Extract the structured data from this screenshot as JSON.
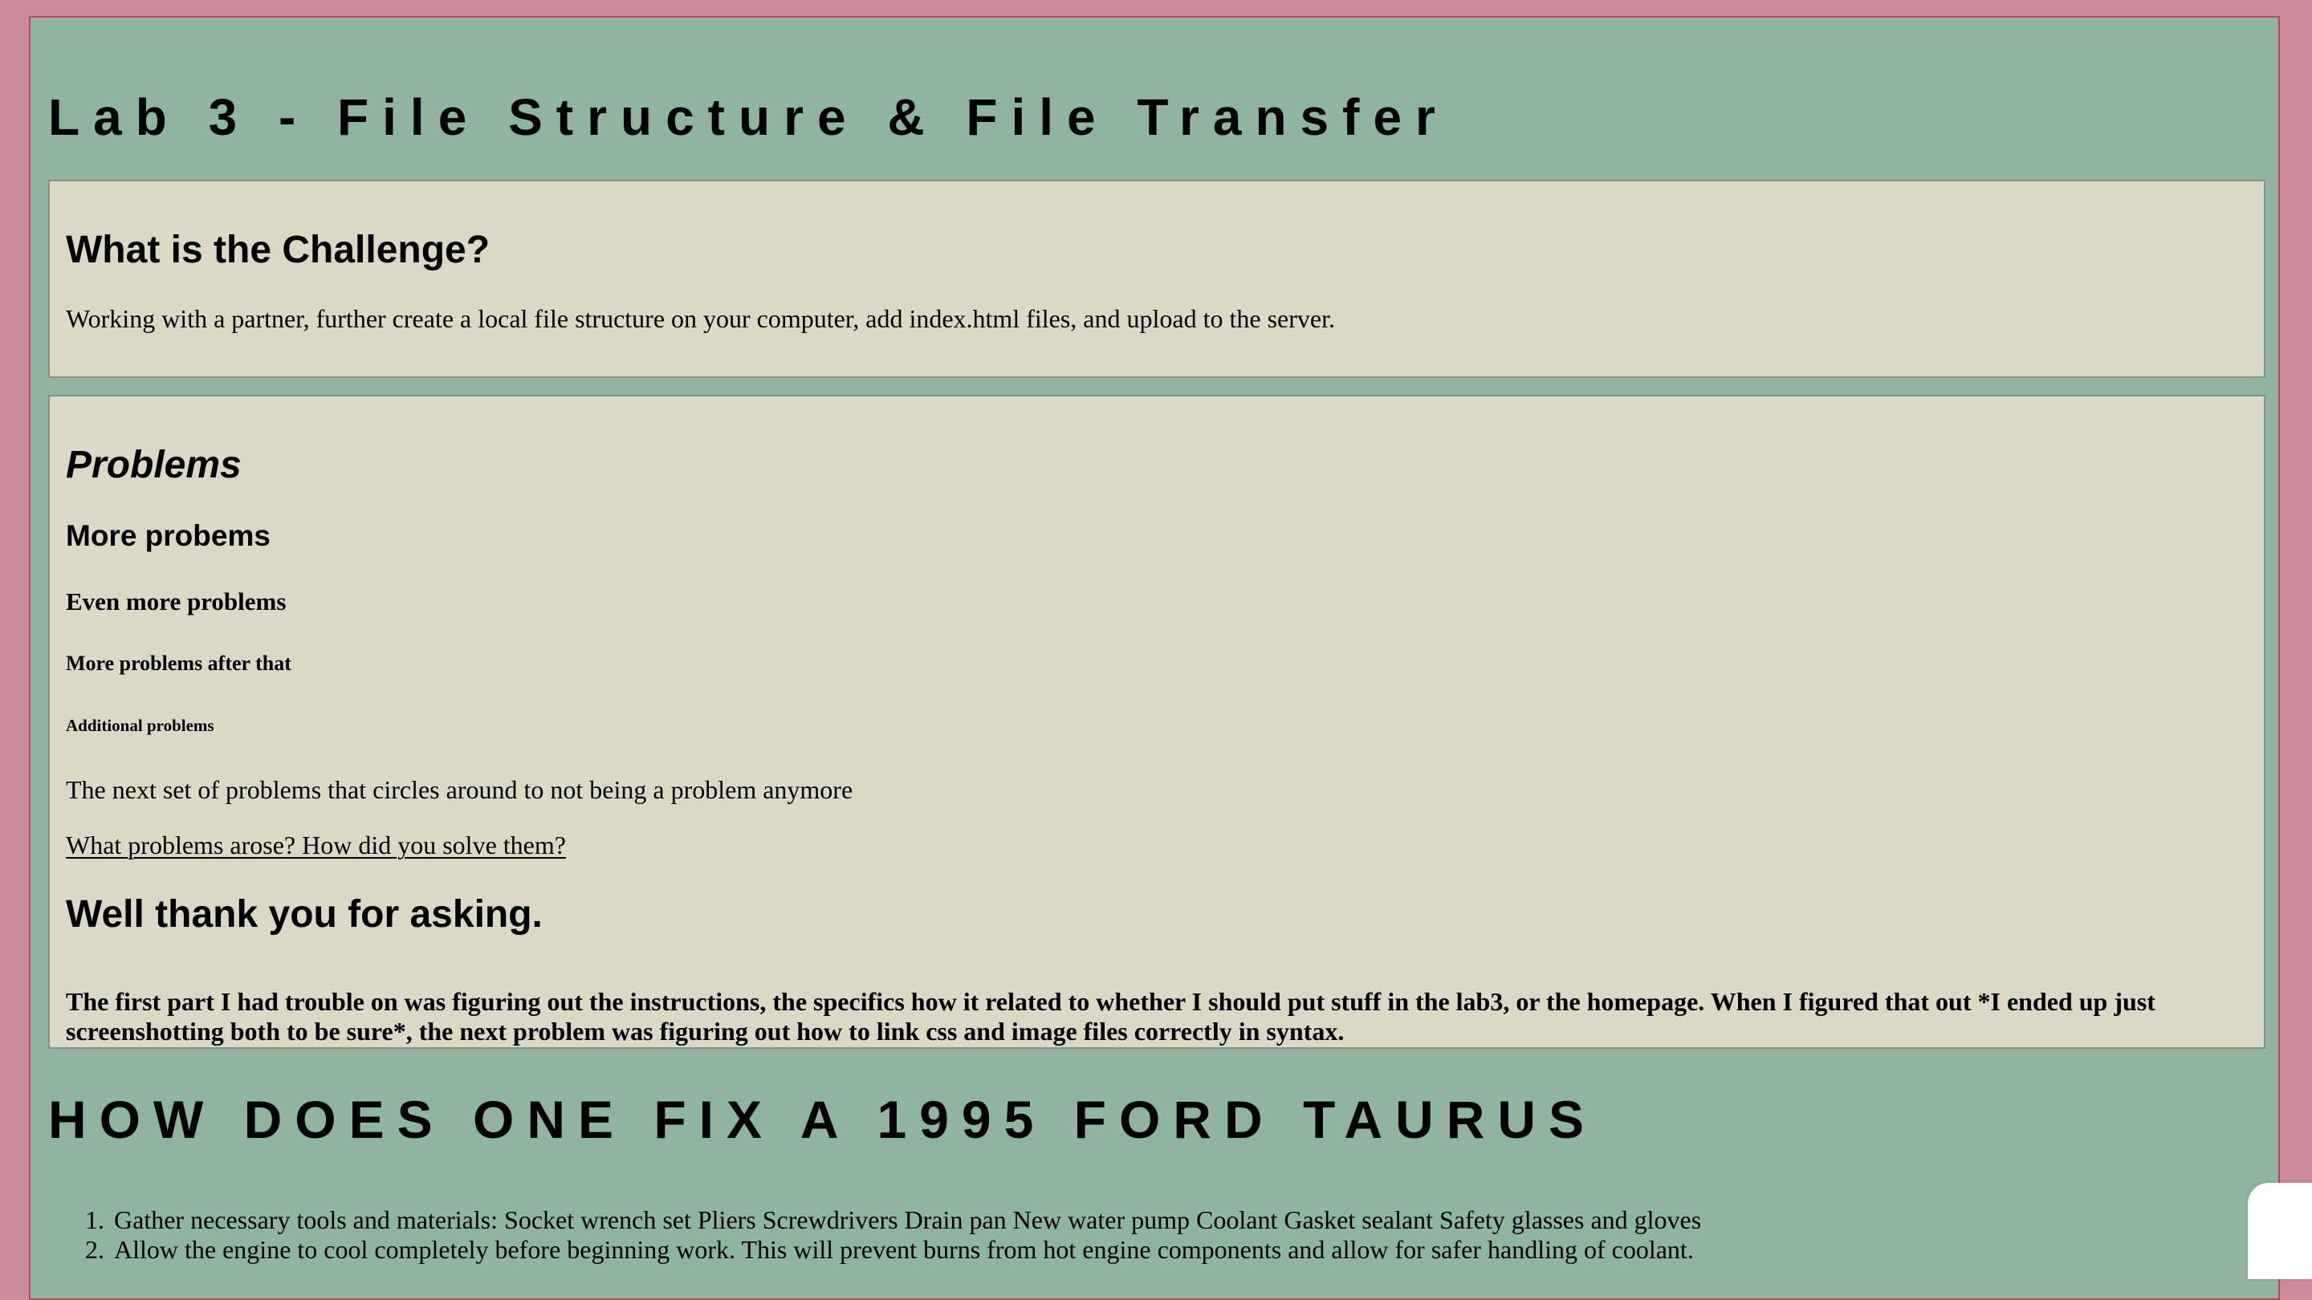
{
  "page_title": "Lab 3 - File Structure & File Transfer",
  "challenge": {
    "heading": "What is the Challenge?",
    "text": "Working with a partner, further create a local file structure on your computer, add index.html files, and upload to the server."
  },
  "problems": {
    "heading_italic": "Problems",
    "h3": "More probems",
    "h4": "Even more problems",
    "h5": "More problems after that",
    "h6": "Additional problems",
    "paragraph": "The next set of problems that circles around to not being a problem anymore",
    "link_text": "What problems arose? How did you solve them?",
    "answer_heading": "Well thank you for asking.",
    "answer_text": "The first part I had trouble on was figuring out the instructions, the specifics how it related to whether I should put stuff in the lab3, or the homepage. When I figured that out *I ended up just screenshotting both to be sure*, the next problem was figuring out how to link css and image files correctly in syntax."
  },
  "taurus": {
    "heading": "HOW DOES ONE FIX A 1995 FORD TAURUS",
    "steps": [
      "Gather necessary tools and materials: Socket wrench set Pliers Screwdrivers Drain pan New water pump Coolant Gasket sealant Safety glasses and gloves",
      "Allow the engine to cool completely before beginning work. This will prevent burns from hot engine components and allow for safer handling of coolant."
    ]
  }
}
